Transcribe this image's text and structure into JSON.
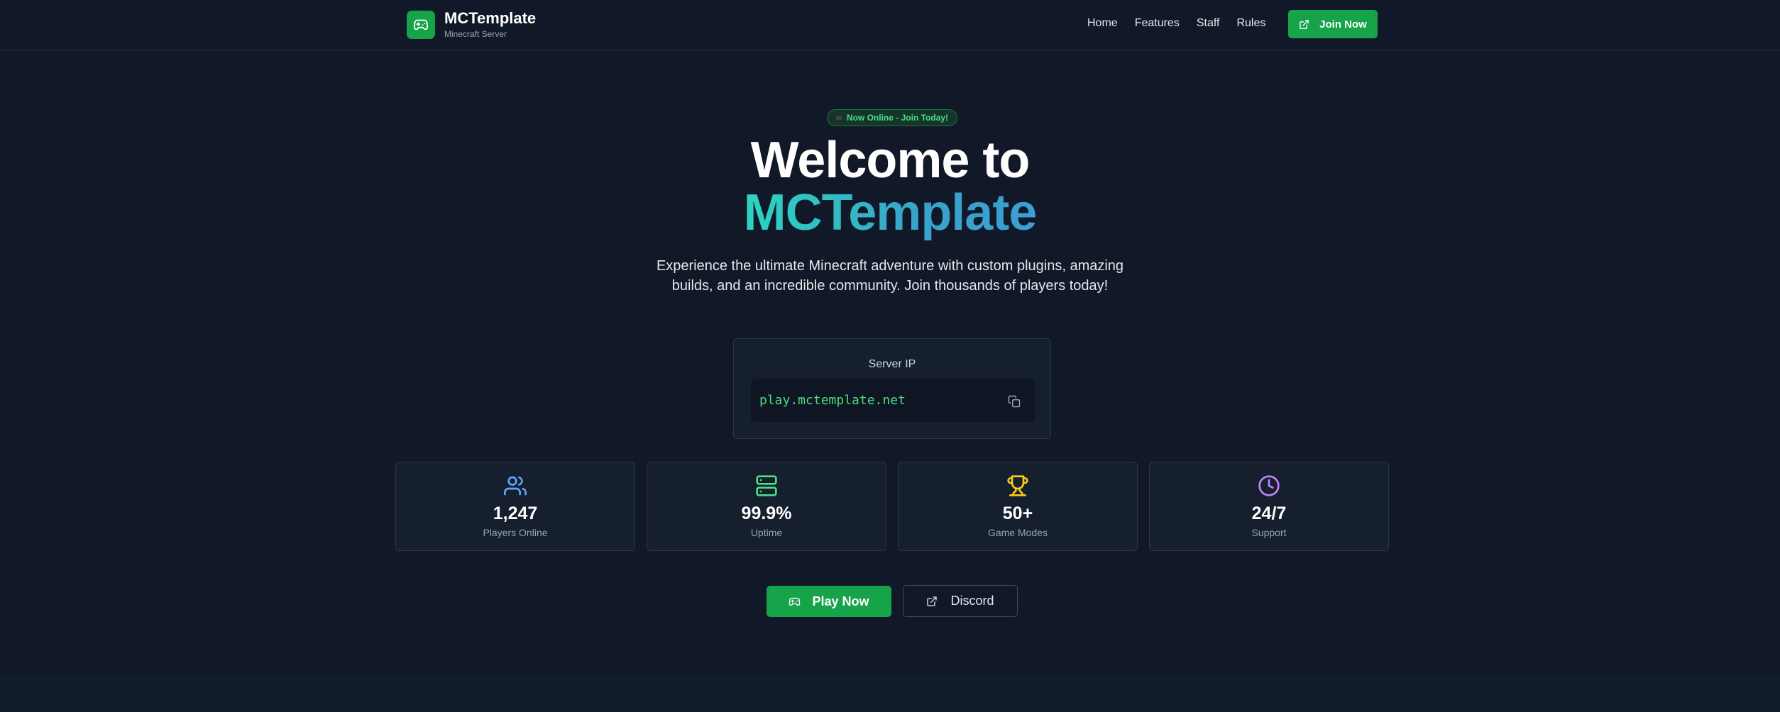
{
  "brand": {
    "title": "MCTemplate",
    "subtitle": "Minecraft Server",
    "logo_icon": "gamepad-icon"
  },
  "nav": {
    "links": [
      "Home",
      "Features",
      "Staff",
      "Rules"
    ],
    "join_label": "Join Now",
    "join_icon": "external-link-icon"
  },
  "hero": {
    "badge": "Now Online - Join Today!",
    "title_line1": "Welcome to",
    "title_line2": "MCTemplate",
    "description": "Experience the ultimate Minecraft adventure with custom plugins, amazing builds, and an incredible community. Join thousands of players today!"
  },
  "server_ip": {
    "label": "Server IP",
    "value": "play.mctemplate.net",
    "copy_icon": "copy-icon"
  },
  "stats": [
    {
      "value": "1,247",
      "label": "Players Online",
      "icon": "users-icon",
      "color": "#60a5fa"
    },
    {
      "value": "99.9%",
      "label": "Uptime",
      "icon": "server-icon",
      "color": "#4ade80"
    },
    {
      "value": "50+",
      "label": "Game Modes",
      "icon": "trophy-icon",
      "color": "#facc15"
    },
    {
      "value": "24/7",
      "label": "Support",
      "icon": "clock-icon",
      "color": "#c084fc"
    }
  ],
  "cta": {
    "play_label": "Play Now",
    "discord_label": "Discord"
  },
  "colors": {
    "background": "#111827",
    "accent": "#16a34a",
    "ip_text": "#4ade80"
  }
}
